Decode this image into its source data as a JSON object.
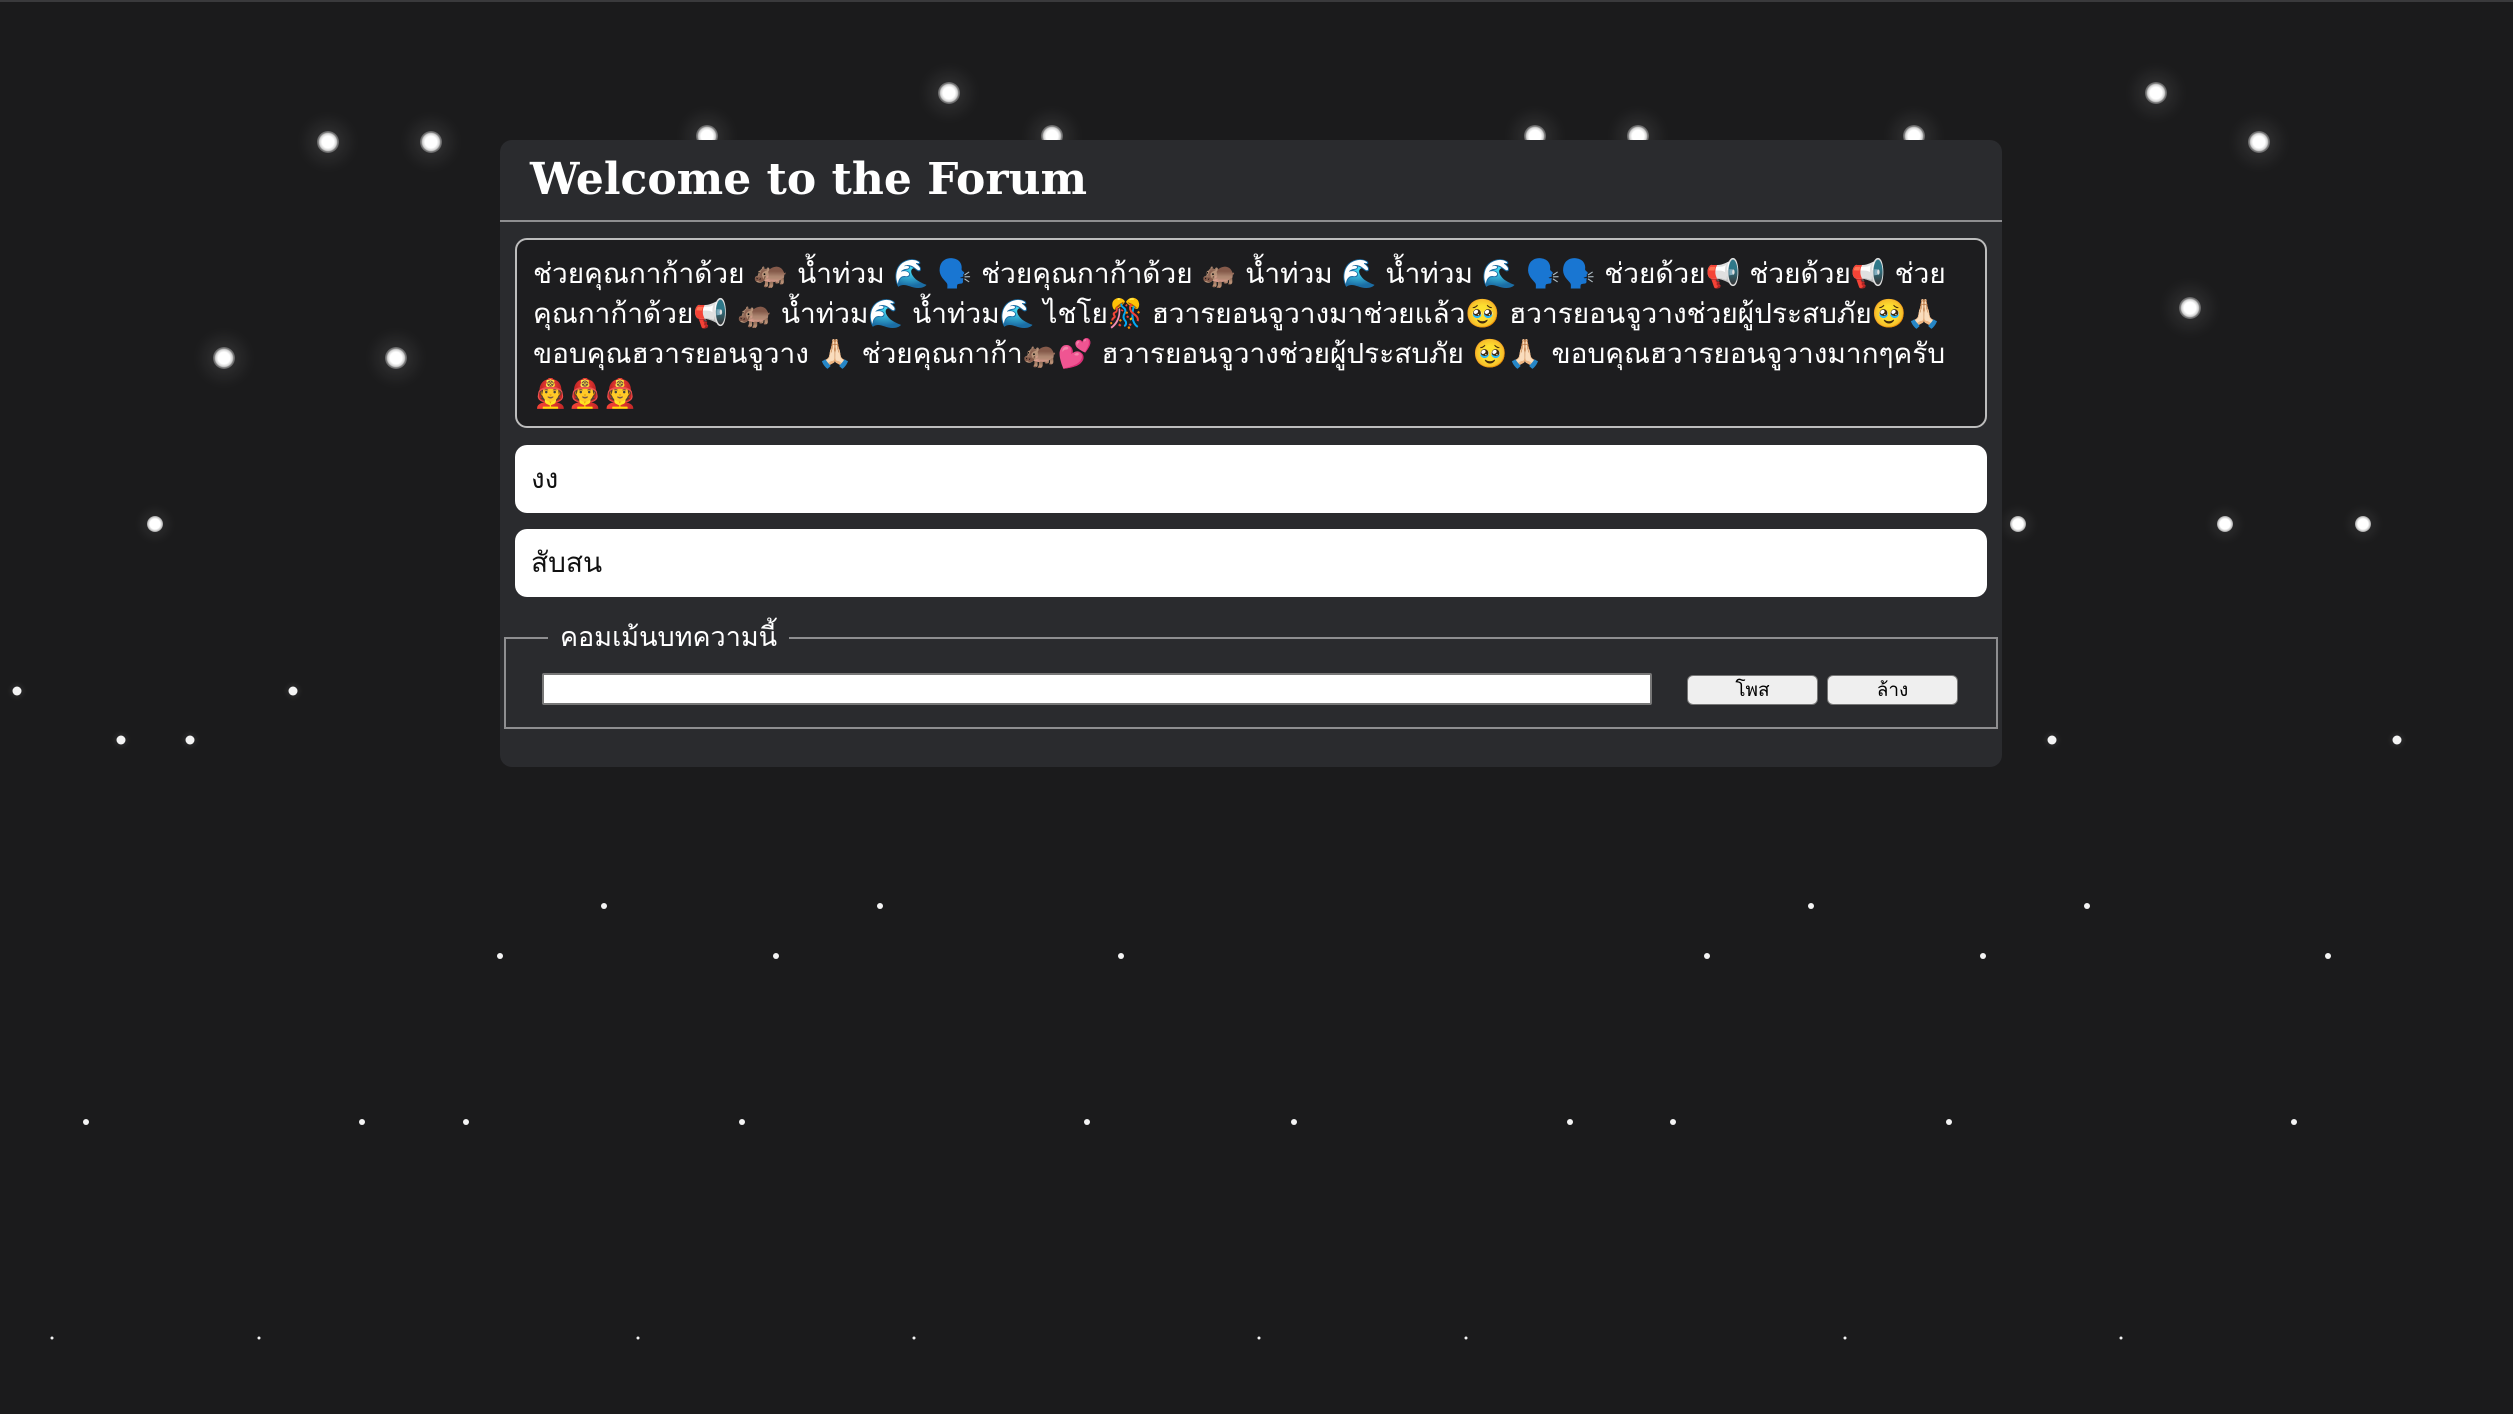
{
  "forum": {
    "title": "Welcome to the Forum"
  },
  "post": {
    "text": "ช่วยคุณกาก้าด้วย 🦛 น้ำท่วม 🌊 🗣️ ช่วยคุณกาก้าด้วย 🦛 น้ำท่วม 🌊 น้ำท่วม 🌊 🗣️🗣️ ช่วยด้วย📢 ช่วยด้วย📢 ช่วยคุณกาก้าด้วย📢 🦛 น้ำท่วม🌊 น้ำท่วม🌊 ไชโย🎊 ฮวารยอนจูวางมาช่วยแล้ว🥹 ฮวารยอนจูวางช่วยผู้ประสบภัย🥹🙏🏻 ขอบคุณฮวารยอนจูวาง 🙏🏻 ช่วยคุณกาก้า🦛💕 ฮวารยอนจูวางช่วยผู้ประสบภัย 🥹🙏🏻 ขอบคุณฮวารยอนจูวางมากๆครับ 🧑‍🚒🧑‍🚒🧑‍🚒"
  },
  "comments": [
    {
      "text": "งง"
    },
    {
      "text": "สับสน"
    }
  ],
  "comment_form": {
    "legend": "คอมเม้นบทความนี้",
    "input_value": "",
    "post_label": "โพส",
    "clear_label": "ล้าง"
  },
  "colors": {
    "background": "#1b1b1c",
    "panel": "#2a2b2e",
    "post_box": "#1d1d1f",
    "text": "#ffffff"
  }
}
